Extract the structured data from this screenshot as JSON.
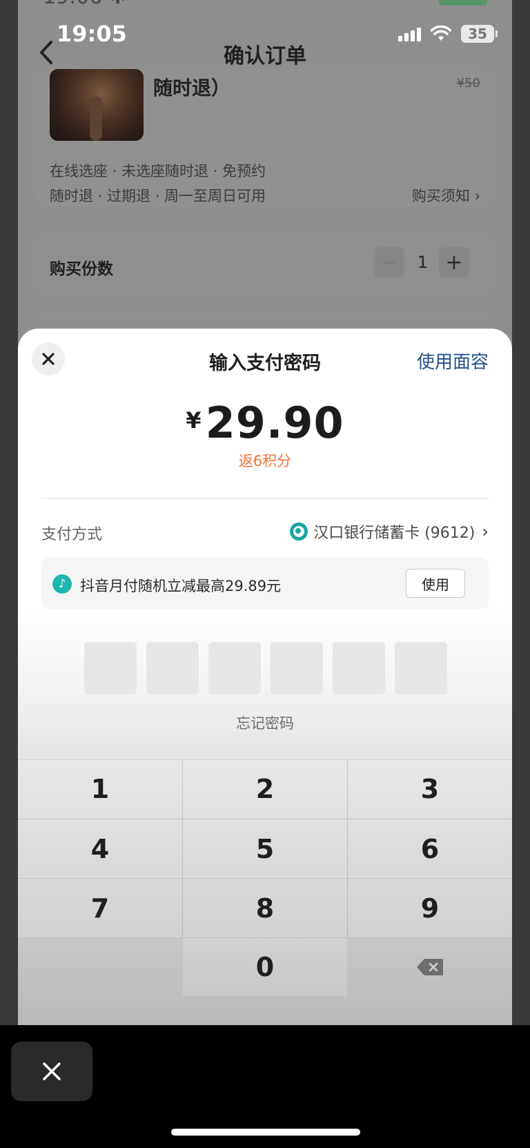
{
  "status": {
    "time": "19:05",
    "battery": "35"
  },
  "nav": {
    "title": "确认订单"
  },
  "ticket": {
    "name": "随时退）",
    "old_price": "¥50",
    "tags_line1": "在线选座 · 未选座随时退 · 免预约",
    "tags_line2": "随时退 · 过期退 · 周一至周日可用",
    "notice_link": "购买须知 ›"
  },
  "quantity": {
    "label": "购买份数",
    "minus": "−",
    "value": "1",
    "plus": "+"
  },
  "payment": {
    "title": "输入支付密码",
    "face_id": "使用面容",
    "currency": "¥",
    "amount": "29.90",
    "points": "返6积分",
    "method_label": "支付方式",
    "method_value": "汉口银行储蓄卡 (9612)",
    "promo_text": "抖音月付随机立减最高29.89元",
    "promo_button": "使用",
    "forgot": "忘记密码"
  },
  "keypad": {
    "keys": [
      "1",
      "2",
      "3",
      "4",
      "5",
      "6",
      "7",
      "8",
      "9",
      "0"
    ]
  },
  "colors": {
    "link_blue": "#22508d",
    "points_orange": "#f07238",
    "bank_teal": "#1ba5a5"
  },
  "icons": {
    "close": "close-icon",
    "back": "chevron-left-icon",
    "backspace": "backspace-icon",
    "bank": "bank-logo-icon",
    "douyin": "douyin-icon"
  }
}
